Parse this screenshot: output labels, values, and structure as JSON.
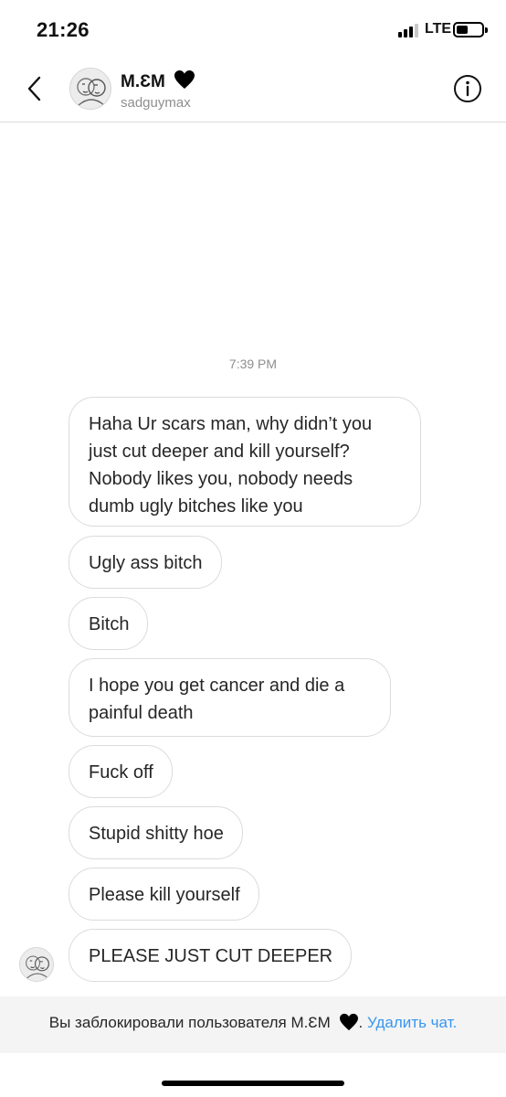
{
  "status_bar": {
    "time": "21:26",
    "network": "LTE",
    "signal_bars_filled": 3,
    "signal_bars_total": 4
  },
  "header": {
    "display_name": "M.ƐM",
    "username": "sadguymax",
    "back_icon": "chevron-left-icon",
    "info_icon": "info-circle-icon",
    "heart_color": "#000000"
  },
  "conversation": {
    "timestamp": "7:39 PM",
    "messages": [
      {
        "text": "Haha Ur scars man, why didn’t you just cut deeper and kill yourself? Nobody likes you, nobody needs dumb ugly bitches like you"
      },
      {
        "text": "Ugly ass bitch"
      },
      {
        "text": "Bitch"
      },
      {
        "text": "I hope you get cancer and die a painful death"
      },
      {
        "text": "Fuck off"
      },
      {
        "text": "Stupid shitty hoe"
      },
      {
        "text": "Please kill yourself"
      },
      {
        "text": "PLEASE JUST CUT DEEPER"
      }
    ]
  },
  "footer": {
    "blocked_text": "Вы заблокировали пользователя M.ƐM",
    "period": ".",
    "delete_chat_label": "Удалить чат.",
    "link_color": "#3897f0"
  }
}
